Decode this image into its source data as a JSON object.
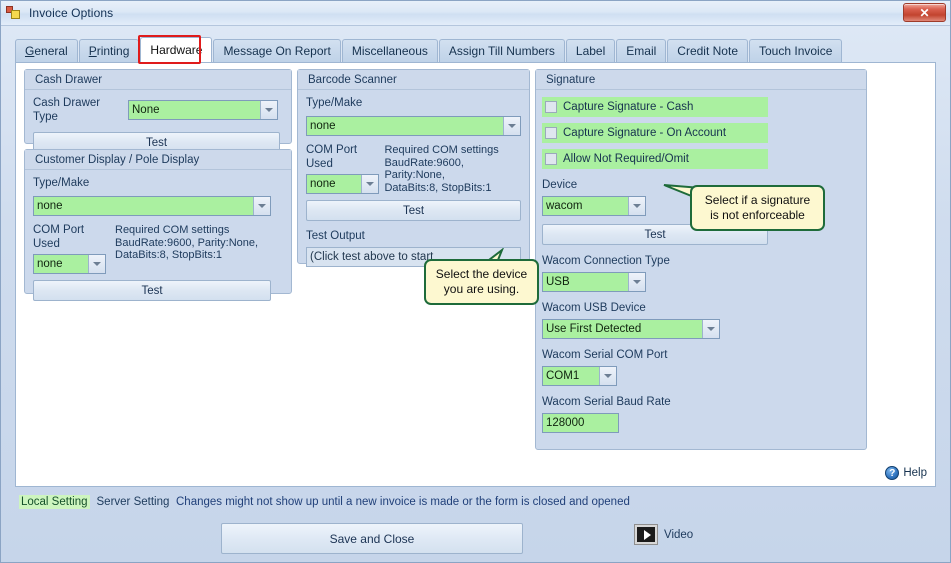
{
  "window": {
    "title": "Invoice Options",
    "app_icon": "vb-form-icon",
    "close_label": "✕"
  },
  "tabs": [
    {
      "label": "General",
      "mnemonic": "G",
      "active": false
    },
    {
      "label": "Printing",
      "mnemonic": "P",
      "active": false
    },
    {
      "label": "Hardware",
      "mnemonic": "",
      "active": true
    },
    {
      "label": "Message On Report",
      "mnemonic": "",
      "active": false
    },
    {
      "label": "Miscellaneous",
      "mnemonic": "",
      "active": false
    },
    {
      "label": "Assign Till Numbers",
      "mnemonic": "",
      "active": false
    },
    {
      "label": "Label",
      "mnemonic": "",
      "active": false
    },
    {
      "label": "Email",
      "mnemonic": "",
      "active": false
    },
    {
      "label": "Credit Note",
      "mnemonic": "",
      "active": false
    },
    {
      "label": "Touch Invoice",
      "mnemonic": "",
      "active": false
    }
  ],
  "cash_drawer": {
    "group_title": "Cash Drawer",
    "type_label": "Cash Drawer Type",
    "type_value": "None",
    "test_label": "Test"
  },
  "customer_display": {
    "group_title": "Customer Display / Pole Display",
    "type_label": "Type/Make",
    "type_value": "none",
    "com_label": "COM Port Used",
    "com_value": "none",
    "req_title": "Required COM settings",
    "req_line1": "BaudRate:9600, Parity:None,",
    "req_line2": "DataBits:8, StopBits:1",
    "test_label": "Test"
  },
  "barcode_scanner": {
    "group_title": "Barcode Scanner",
    "type_label": "Type/Make",
    "type_value": "none",
    "com_label": "COM Port Used",
    "com_value": "none",
    "req_title": "Required COM settings",
    "req_line1": "BaudRate:9600, Parity:None,",
    "req_line2": "DataBits:8, StopBits:1",
    "test_label": "Test",
    "test_output_label": "Test Output",
    "test_output_value": "(Click test above to start"
  },
  "signature": {
    "group_title": "Signature",
    "checkboxes": [
      {
        "label": "Capture Signature - Cash",
        "checked": false
      },
      {
        "label": "Capture Signature - On Account",
        "checked": false
      },
      {
        "label": "Allow Not Required/Omit",
        "checked": false
      }
    ],
    "device_label": "Device",
    "device_value": "wacom",
    "test_label": "Test",
    "conn_label": "Wacom Connection Type",
    "conn_value": "USB",
    "usb_label": "Wacom USB Device",
    "usb_value": "Use First Detected",
    "serial_com_label": "Wacom Serial COM Port",
    "serial_com_value": "COM1",
    "baud_label": "Wacom Serial Baud Rate",
    "baud_value": "128000"
  },
  "callouts": {
    "device_tip_line1": "Select the device",
    "device_tip_line2": "you are using.",
    "signature_tip_line1": "Select if a signature",
    "signature_tip_line2": "is not enforceable"
  },
  "help": {
    "label": "Help",
    "icon": "question-mark-icon"
  },
  "footer": {
    "legend_local": "Local Setting",
    "legend_server": "Server Setting",
    "changes_note": "Changes might not show up until a new invoice is made or the form is closed and opened",
    "save_label": "Save and Close",
    "video_label": "Video"
  },
  "colors": {
    "accent_green": "#aaf0a0",
    "panel_blue": "#ccd9ec",
    "window_blue": "#cfdcee",
    "marker_red": "#e01b1b",
    "callout_yellow": "#fdf8d0",
    "callout_border_green": "#1e6b3a"
  }
}
